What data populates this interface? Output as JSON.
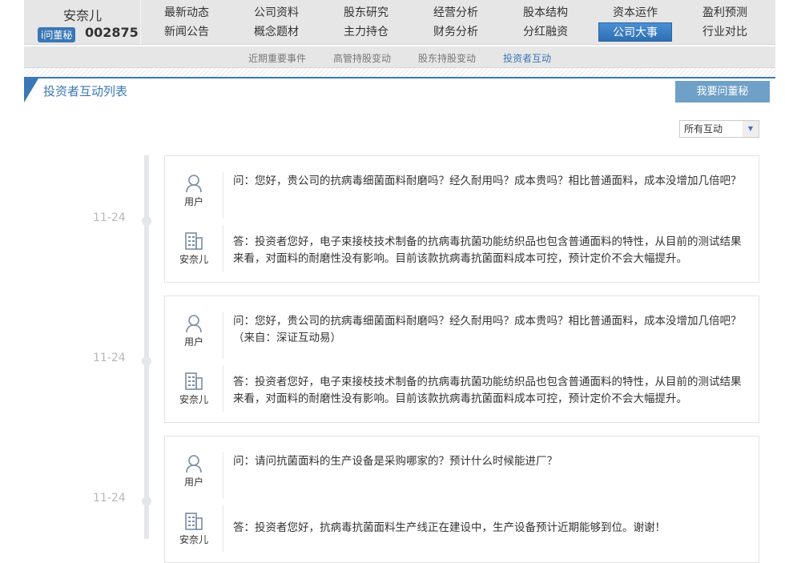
{
  "header": {
    "company": "安奈儿",
    "badge": "i问董秘",
    "code": "002875"
  },
  "nav": [
    [
      "最新动态",
      "新闻公告"
    ],
    [
      "公司资料",
      "概念题材"
    ],
    [
      "股东研究",
      "主力持仓"
    ],
    [
      "经营分析",
      "财务分析"
    ],
    [
      "股本结构",
      "分红融资"
    ],
    [
      "资本运作",
      "公司大事"
    ],
    [
      "盈利预测",
      "行业对比"
    ]
  ],
  "nav_active": "公司大事",
  "subnav": [
    "近期重要事件",
    "高管持股变动",
    "股东持股变动",
    "投资者互动"
  ],
  "subnav_active": "投资者互动",
  "panel": {
    "title": "投资者互动列表",
    "ask_button": "我要问董秘",
    "filter": "所有互动"
  },
  "items": [
    {
      "date": "11-24",
      "asker": "用户",
      "question": "问：您好，贵公司的抗病毒细菌面料耐磨吗？经久耐用吗？成本贵吗？相比普通面料，成本没增加几倍吧？",
      "answerer": "安奈儿",
      "answer": "答：投资者您好，电子束接枝技术制备的抗病毒抗菌功能纺织品也包含普通面料的特性，从目前的测试结果来看，对面料的耐磨性没有影响。目前该款抗病毒抗菌面料成本可控，预计定价不会大幅提升。"
    },
    {
      "date": "11-24",
      "asker": "用户",
      "question": "问：您好，贵公司的抗病毒细菌面料耐磨吗？经久耐用吗？成本贵吗？相比普通面料，成本没增加几倍吧？（来自：深证互动易）",
      "answerer": "安奈儿",
      "answer": "答：投资者您好，电子束接枝技术制备的抗病毒抗菌功能纺织品也包含普通面料的特性，从目前的测试结果来看，对面料的耐磨性没有影响。目前该款抗病毒抗菌面料成本可控，预计定价不会大幅提升。"
    },
    {
      "date": "11-24",
      "asker": "用户",
      "question": "问：请问抗菌面料的生产设备是采购哪家的？预计什么时候能进厂？",
      "answerer": "安奈儿",
      "answer": "答：投资者您好，抗病毒抗菌面料生产线正在建设中，生产设备预计近期能够到位。谢谢！"
    }
  ]
}
